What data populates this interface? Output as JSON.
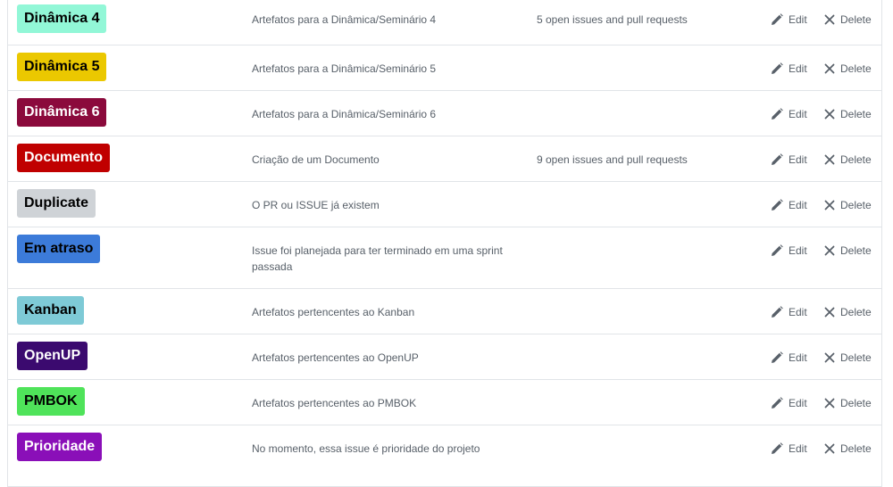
{
  "actions": {
    "edit_label": "Edit",
    "delete_label": "Delete"
  },
  "labels": [
    {
      "name": "Dinâmica 4",
      "description": "Artefatos para a Dinâmica/Seminário 4",
      "issues": "5 open issues and pull requests",
      "bg": "#92f7d7",
      "fg": "#000000"
    },
    {
      "name": "Dinâmica 5",
      "description": "Artefatos para a Dinâmica/Seminário 5",
      "issues": "",
      "bg": "#ebc800",
      "fg": "#000000"
    },
    {
      "name": "Dinâmica 6",
      "description": "Artefatos para a Dinâmica/Seminário 6",
      "issues": "",
      "bg": "#8b0a3c",
      "fg": "#ffffff"
    },
    {
      "name": "Documento",
      "description": "Criação de um Documento",
      "issues": "9 open issues and pull requests",
      "bg": "#c00000",
      "fg": "#ffffff"
    },
    {
      "name": "Duplicate",
      "description": "O PR ou ISSUE já existem",
      "issues": "",
      "bg": "#cfd3d7",
      "fg": "#000000"
    },
    {
      "name": "Em atraso",
      "description": "Issue foi planejada para ter terminado em uma sprint passada",
      "issues": "",
      "bg": "#3c7bd9",
      "fg": "#000000"
    },
    {
      "name": "Kanban",
      "description": "Artefatos pertencentes ao Kanban",
      "issues": "",
      "bg": "#7ecad6",
      "fg": "#000000"
    },
    {
      "name": "OpenUP",
      "description": "Artefatos pertencentes ao OpenUP",
      "issues": "",
      "bg": "#3b0a6f",
      "fg": "#ffffff"
    },
    {
      "name": "PMBOK",
      "description": "Artefatos pertencentes ao PMBOK",
      "issues": "",
      "bg": "#4fe35a",
      "fg": "#000000"
    },
    {
      "name": "Prioridade",
      "description": "No momento, essa issue é prioridade do projeto",
      "issues": "",
      "bg": "#8a0fb8",
      "fg": "#ffffff"
    }
  ]
}
